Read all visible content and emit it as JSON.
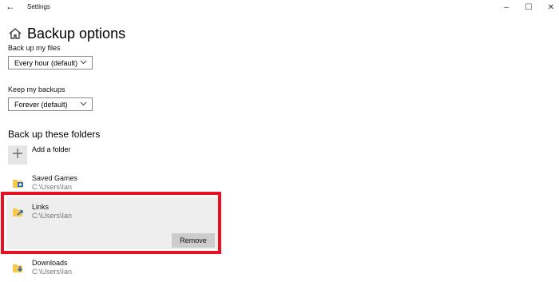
{
  "window": {
    "title": "Settings",
    "back_icon": "←",
    "minimize_icon": "–",
    "maximize_icon": "☐",
    "close_icon": "✕"
  },
  "page": {
    "title": "Backup options"
  },
  "backup_frequency": {
    "label": "Back up my files",
    "selected": "Every hour (default)"
  },
  "retention": {
    "label": "Keep my backups",
    "selected": "Forever (default)"
  },
  "folders_section": {
    "title": "Back up these folders",
    "add_label": "Add a folder",
    "items": [
      {
        "name": "Saved Games",
        "path": "C:\\Users\\Ian"
      },
      {
        "name": "Links",
        "path": "C:\\Users\\Ian"
      },
      {
        "name": "Downloads",
        "path": "C:\\Users\\Ian"
      }
    ],
    "remove_label": "Remove"
  },
  "colors": {
    "highlight": "#e81123",
    "selected_row": "#eeeeee",
    "button": "#cccccc"
  }
}
